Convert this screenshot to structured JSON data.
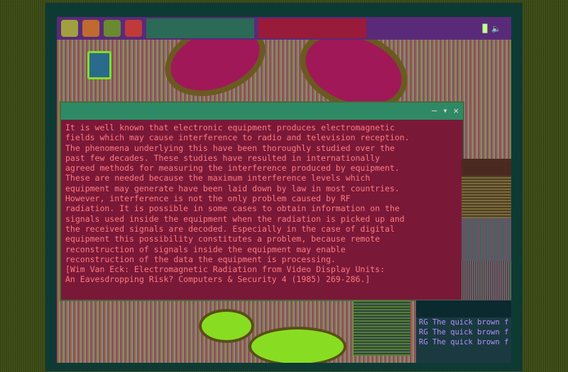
{
  "taskbar": {
    "icons": [
      "app-menu-icon",
      "browser-icon",
      "files-icon",
      "image-viewer-icon"
    ],
    "tasks": [
      "",
      ""
    ],
    "tray_icons": [
      "network-icon",
      "volume-icon"
    ],
    "clock": ""
  },
  "desktop": {
    "trash_label": ""
  },
  "window": {
    "title": "",
    "controls": [
      "minimize",
      "maximize",
      "close"
    ],
    "text": "It is well known that electronic equipment produces electromagnetic\nfields which may cause interference to radio and television reception.\nThe phenomena underlying this have been thoroughly studied over the\npast few decades. These studies have resulted in internationally\nagreed methods for measuring the interference produced by equipment.\nThese are needed because the maximum interference levels which\nequipment may generate have been laid down by law in most countries.\nHowever, interference is not the only problem caused by RF\nradiation. It is possible in some cases to obtain information on the\nsignals used inside the equipment when the radiation is picked up and\nthe received signals are decoded. Especially in the case of digital\nequipment this possibility constitutes a problem, because remote\nreconstruction of signals inside the equipment may enable\nreconstruction of the data the equipment is processing.\n[Wim Van Eck: Electromagnetic Radiation from Video Display Units:\nAn Eavesdropping Risk? Computers & Security 4 (1985) 269-286.]"
  },
  "terminal": {
    "lines": [
      "RG The quick brown f",
      "RG The quick brown f",
      "RG The quick brown f"
    ]
  },
  "colors": {
    "background": "#3a4a12",
    "bezel": "#0e3a34",
    "window_bg": "#7a1838",
    "window_text": "#ff7a80",
    "titlebar": "#2e8a64",
    "taskbar": "#5a2a7a"
  }
}
